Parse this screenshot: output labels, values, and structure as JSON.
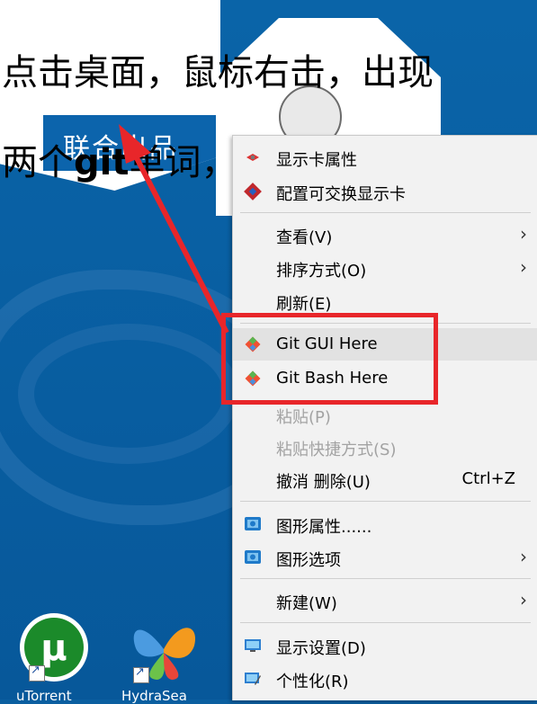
{
  "caption": {
    "line1": "点击桌面，鼠标右击，出现",
    "line2_pre": "两个",
    "line2_git": "git",
    "line2_post": "单词，则安装成功"
  },
  "wallpaper": {
    "banner_label": "联合出品"
  },
  "desktop_icons": [
    {
      "name": "uTorrent",
      "label": "uTorrent",
      "icon": "utorrent-icon"
    },
    {
      "name": "HydraSea",
      "label": "HydraSea",
      "icon": "butterfly-icon"
    }
  ],
  "context_menu": {
    "items": [
      {
        "label": "显示卡属性",
        "icon": "graphics-properties-icon",
        "disabled": false
      },
      {
        "label": "配置可交换显示卡",
        "icon": "switchable-graphics-icon",
        "disabled": false
      },
      {
        "label": "查看(V)",
        "submenu": true
      },
      {
        "label": "排序方式(O)",
        "submenu": true
      },
      {
        "label": "刷新(E)"
      },
      {
        "label": "Git GUI Here",
        "icon": "git-icon",
        "highlighted": true
      },
      {
        "label": "Git Bash Here",
        "icon": "git-icon"
      },
      {
        "label": "粘贴(P)",
        "disabled": true
      },
      {
        "label": "粘贴快捷方式(S)",
        "disabled": true
      },
      {
        "label": "撤消 删除(U)",
        "shortcut": "Ctrl+Z"
      },
      {
        "label": "图形属性......",
        "icon": "intel-graphics-icon"
      },
      {
        "label": "图形选项",
        "icon": "intel-graphics-icon",
        "submenu": true
      },
      {
        "label": "新建(W)",
        "submenu": true
      },
      {
        "label": "显示设置(D)",
        "icon": "display-settings-icon"
      },
      {
        "label": "个性化(R)",
        "icon": "personalize-icon"
      }
    ]
  },
  "colors": {
    "highlight_box": "#e8262a",
    "menu_bg": "#f2f2f2",
    "wallpaper_blue": "#0b5fa0"
  }
}
